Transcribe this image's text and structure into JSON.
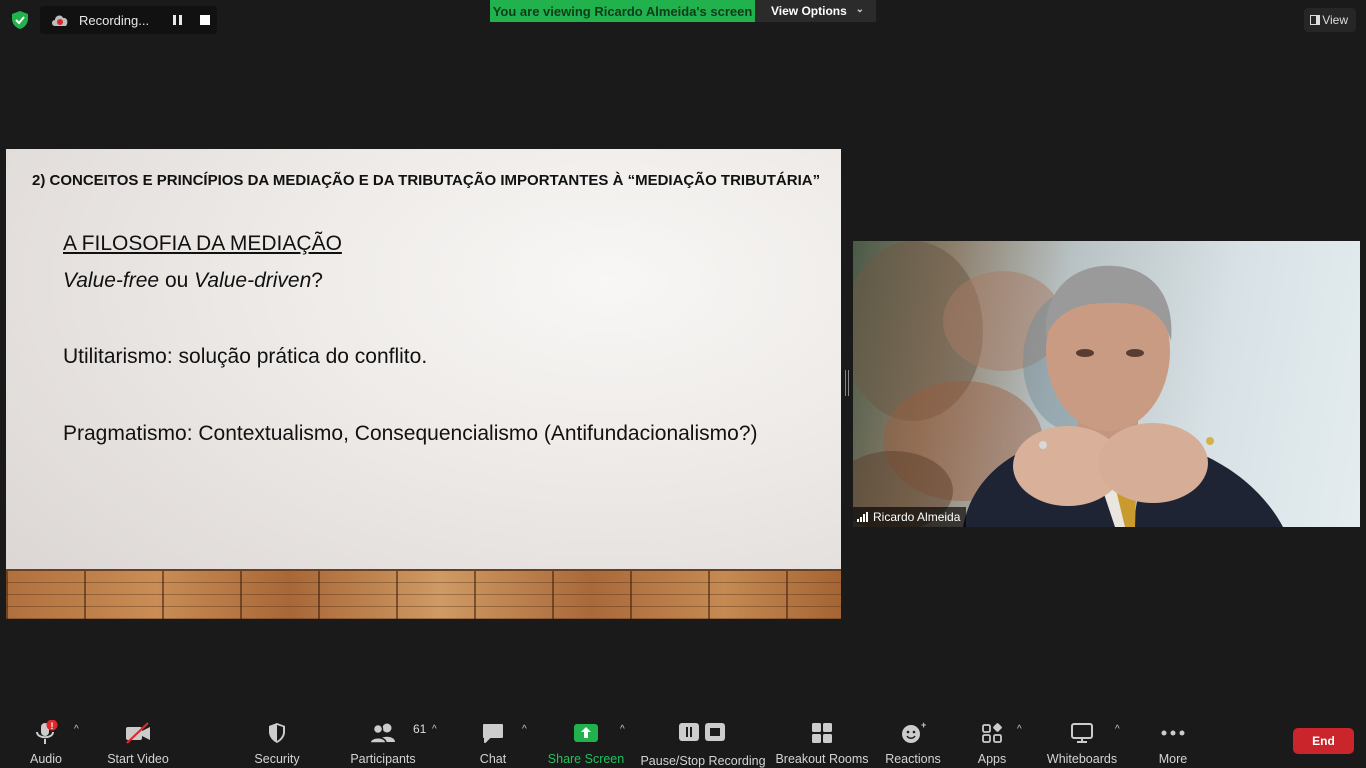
{
  "recording": {
    "status_text": "Recording..."
  },
  "banner": {
    "text": "You are viewing Ricardo Almeida's screen",
    "view_options": "View Options"
  },
  "view_button": {
    "label": "View"
  },
  "slide": {
    "heading": "2) CONCEITOS E PRINCÍPIOS DA MEDIAÇÃO E DA TRIBUTAÇÃO IMPORTANTES À “MEDIAÇÃO TRIBUTÁRIA”",
    "subtitle": "A FILOSOFIA DA MEDIAÇÃO",
    "question": {
      "part1": "Value-free",
      "part2": " ou ",
      "part3": "Value-driven",
      "part4": "?"
    },
    "utilitarismo": "Utilitarismo: solução prática do conflito.",
    "pragmatismo": "Pragmatismo: Contextualismo, Consequencialismo (Antifundacionalismo?)"
  },
  "participant": {
    "name": "Ricardo Almeida"
  },
  "toolbar": {
    "audio": "Audio",
    "start_video": "Start Video",
    "security": "Security",
    "participants": "Participants",
    "participants_count": "61",
    "chat": "Chat",
    "share_screen": "Share Screen",
    "pause_stop_recording": "Pause/Stop Recording",
    "breakout_rooms": "Breakout Rooms",
    "reactions": "Reactions",
    "apps": "Apps",
    "whiteboards": "Whiteboards",
    "more": "More",
    "end": "End"
  },
  "colors": {
    "share_green": "#21b14d",
    "end_red": "#c9252a",
    "background": "#1a1a1a"
  }
}
